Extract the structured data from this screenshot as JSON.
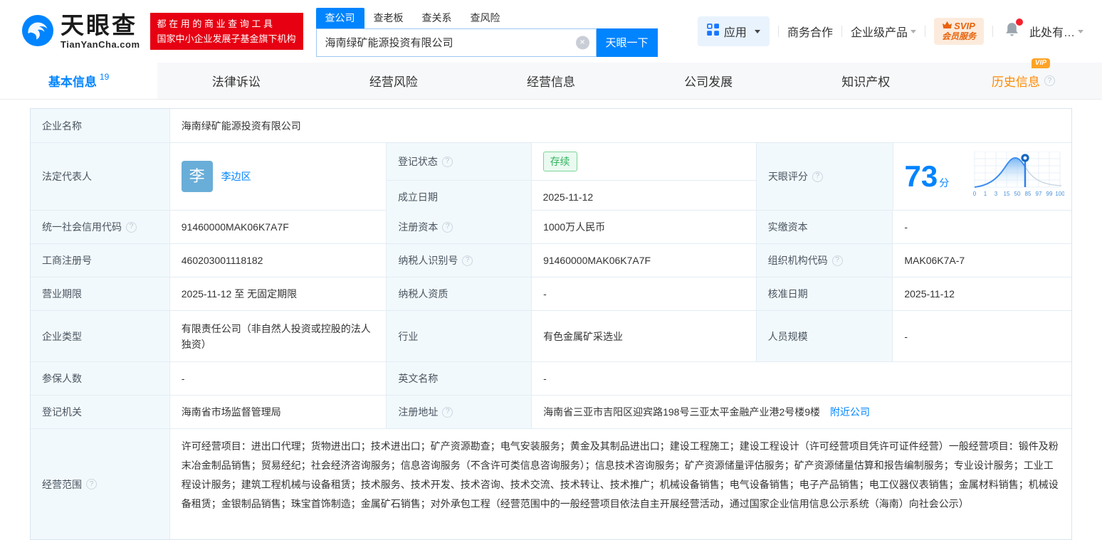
{
  "brand": {
    "name": "天眼查",
    "domain": "TianYanCha.com",
    "slogan_line1": "都 在 用 的 商 业 查 询 工 具",
    "slogan_line2": "国家中小企业发展子基金旗下机构"
  },
  "search": {
    "tabs": [
      "查公司",
      "查老板",
      "查关系",
      "查风险"
    ],
    "input_value": "海南绿矿能源投资有限公司",
    "button_label": "天眼一下"
  },
  "header_right": {
    "apps": "应用",
    "coop": "商务合作",
    "enterprise": "企业级产品",
    "svip_top": "SVIP",
    "svip_bottom": "会员服务",
    "user": "此处有…"
  },
  "nav": {
    "tabs": [
      {
        "label": "基本信息",
        "count": "19"
      },
      {
        "label": "法律诉讼"
      },
      {
        "label": "经营风险"
      },
      {
        "label": "经营信息"
      },
      {
        "label": "公司发展"
      },
      {
        "label": "知识产权"
      },
      {
        "label": "历史信息",
        "vip": "VIP"
      }
    ]
  },
  "table": {
    "company_name": {
      "label": "企业名称",
      "value": "海南绿矿能源投资有限公司"
    },
    "legal_rep": {
      "label": "法定代表人",
      "avatar": "李",
      "name": "李边区"
    },
    "reg_status": {
      "label": "登记状态",
      "value": "存续"
    },
    "establish_date": {
      "label": "成立日期",
      "value": "2025-11-12"
    },
    "score": {
      "label": "天眼评分",
      "value": "73",
      "unit": "分",
      "axis": [
        "0",
        "1",
        "3",
        "15",
        "50",
        "85",
        "97",
        "99",
        "100"
      ]
    },
    "credit_code": {
      "label": "统一社会信用代码",
      "value": "91460000MAK06K7A7F"
    },
    "reg_capital": {
      "label": "注册资本",
      "value": "1000万人民币"
    },
    "paid_capital": {
      "label": "实缴资本",
      "value": "-"
    },
    "reg_number": {
      "label": "工商注册号",
      "value": "460203001118182"
    },
    "taxpayer_id": {
      "label": "纳税人识别号",
      "value": "91460000MAK06K7A7F"
    },
    "org_code": {
      "label": "组织机构代码",
      "value": "MAK06K7A-7"
    },
    "business_term": {
      "label": "营业期限",
      "value": "2025-11-12 至 无固定期限"
    },
    "taxpayer_quality": {
      "label": "纳税人资质",
      "value": "-"
    },
    "approval_date": {
      "label": "核准日期",
      "value": "2025-11-12"
    },
    "company_type": {
      "label": "企业类型",
      "value": "有限责任公司（非自然人投资或控股的法人独资）"
    },
    "industry": {
      "label": "行业",
      "value": "有色金属矿采选业"
    },
    "staff_size": {
      "label": "人员规模",
      "value": "-"
    },
    "insured_count": {
      "label": "参保人数",
      "value": "-"
    },
    "english_name": {
      "label": "英文名称",
      "value": "-"
    },
    "reg_authority": {
      "label": "登记机关",
      "value": "海南省市场监督管理局"
    },
    "reg_address": {
      "label": "注册地址",
      "value": "海南省三亚市吉阳区迎宾路198号三亚太平金融产业港2号楼9楼",
      "link": "附近公司"
    },
    "business_scope": {
      "label": "经营范围",
      "value": "许可经营项目：进出口代理；货物进出口；技术进出口；矿产资源勘查；电气安装服务；黄金及其制品进出口；建设工程施工；建设工程设计（许可经营项目凭许可证件经营）一般经营项目：锻件及粉末冶金制品销售；贸易经纪；社会经济咨询服务；信息咨询服务（不含许可类信息咨询服务）；信息技术咨询服务；矿产资源储量评估服务；矿产资源储量估算和报告编制服务；专业设计服务；工业工程设计服务；建筑工程机械与设备租赁；技术服务、技术开发、技术咨询、技术交流、技术转让、技术推广；机械设备销售；电气设备销售；电子产品销售；电工仪器仪表销售；金属材料销售；机械设备租赁；金银制品销售；珠宝首饰制造；金属矿石销售；对外承包工程（经营范围中的一般经营项目依法自主开展经营活动，通过国家企业信用信息公示系统（海南）向社会公示）"
    }
  },
  "colors": {
    "primary": "#0084ff",
    "banner_red": "#e60012",
    "history_orange": "#ff8a00",
    "status_green": "#2fb35d"
  }
}
